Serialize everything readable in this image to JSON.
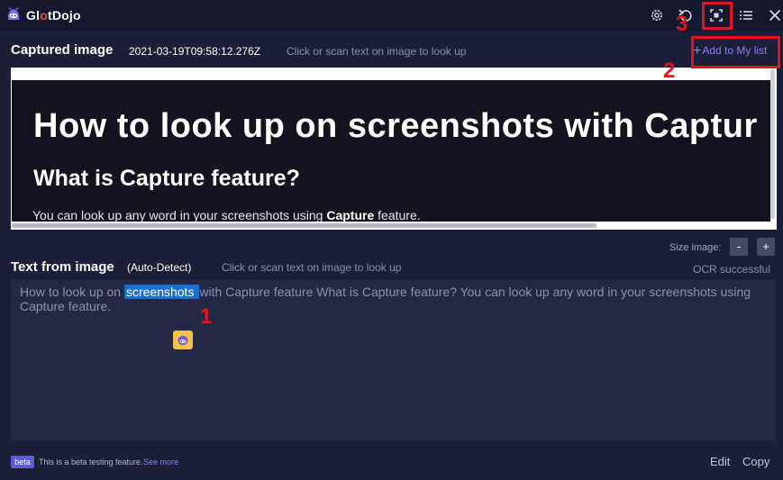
{
  "colors": {
    "background": "#1c1f38",
    "titlebar": "#161830",
    "accent": "#8f7cf6",
    "highlight": "#1a6fd0",
    "annotation": "#e0141c"
  },
  "app": {
    "name_prefix": "Gl",
    "name_o": "o",
    "name_suffix": "tDojo"
  },
  "titlebar": {
    "icons": [
      "gear-icon",
      "undo-icon",
      "capture-icon",
      "list-icon",
      "close-icon"
    ]
  },
  "captured": {
    "title": "Captured image",
    "timestamp": "2021-03-19T09:58:12.276Z",
    "hint": "Click or scan text on image to look up",
    "add_label": "Add to My list",
    "image": {
      "heading": "How to look up on screenshots with Captur",
      "subheading": "What is Capture feature?",
      "body_before": "You can look  up any word in your screenshots  using ",
      "body_bold": "Capture",
      "body_after": " feature."
    },
    "size_label": "Size image:",
    "size_minus": "-",
    "size_plus": "+"
  },
  "text_section": {
    "title": "Text from image",
    "mode": "(Auto-Detect)",
    "hint": "Click or scan text on image to look up",
    "status": "OCR successful",
    "text_before": "How to look up on ",
    "text_highlight": "screenshots ",
    "text_after": "with Capture feature What is Capture feature? You can look up any word in your screenshots using Capture feature."
  },
  "annotations": {
    "label_1": "1",
    "label_2": "2",
    "label_3": "3"
  },
  "footer": {
    "badge": "beta",
    "beta_text": "This is a beta testing feature.",
    "see_more": "See more",
    "edit": "Edit",
    "copy": "Copy"
  }
}
